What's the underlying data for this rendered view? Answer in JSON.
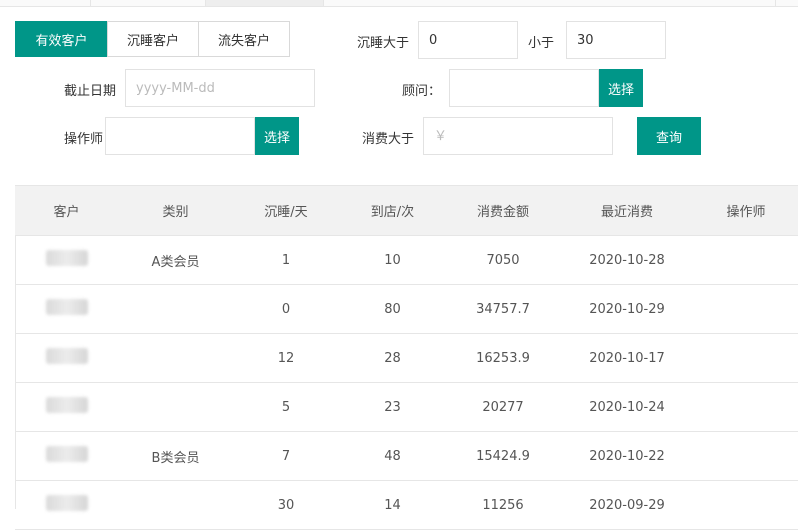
{
  "filters": {
    "tabs": [
      {
        "label": "有效客户",
        "active": true
      },
      {
        "label": "沉睡客户",
        "active": false
      },
      {
        "label": "流失客户",
        "active": false
      }
    ],
    "sleep_gt_label": "沉睡大于",
    "sleep_gt_value": "0",
    "less_than_label": "小于",
    "less_than_value": "30",
    "deadline_label": "截止日期",
    "deadline_placeholder": "yyyy-MM-dd",
    "advisor_label": "顾问：",
    "advisor_value": "",
    "advisor_select": "选择",
    "operator_label": "操作师",
    "operator_value": "",
    "operator_select": "选择",
    "spend_gt_label": "消费大于",
    "spend_gt_placeholder": "￥",
    "query_button": "查询"
  },
  "table": {
    "columns": [
      "客户",
      "类别",
      "沉睡/天",
      "到店/次",
      "消费金额",
      "最近消费",
      "操作师"
    ],
    "rows": [
      {
        "customer": "",
        "category": "A类会员",
        "sleep_days": "1",
        "visits": "10",
        "amount": "7050",
        "last": "2020-10-28",
        "operator": ""
      },
      {
        "customer": "",
        "category": "",
        "sleep_days": "0",
        "visits": "80",
        "amount": "34757.7",
        "last": "2020-10-29",
        "operator": ""
      },
      {
        "customer": "",
        "category": "",
        "sleep_days": "12",
        "visits": "28",
        "amount": "16253.9",
        "last": "2020-10-17",
        "operator": ""
      },
      {
        "customer": "",
        "category": "",
        "sleep_days": "5",
        "visits": "23",
        "amount": "20277",
        "last": "2020-10-24",
        "operator": ""
      },
      {
        "customer": "",
        "category": "B类会员",
        "sleep_days": "7",
        "visits": "48",
        "amount": "15424.9",
        "last": "2020-10-22",
        "operator": ""
      },
      {
        "customer": "",
        "category": "",
        "sleep_days": "30",
        "visits": "14",
        "amount": "11256",
        "last": "2020-09-29",
        "operator": ""
      }
    ]
  },
  "colors": {
    "accent": "#009688",
    "header_bg": "#f2f2f2",
    "border": "#e6e6e6"
  }
}
